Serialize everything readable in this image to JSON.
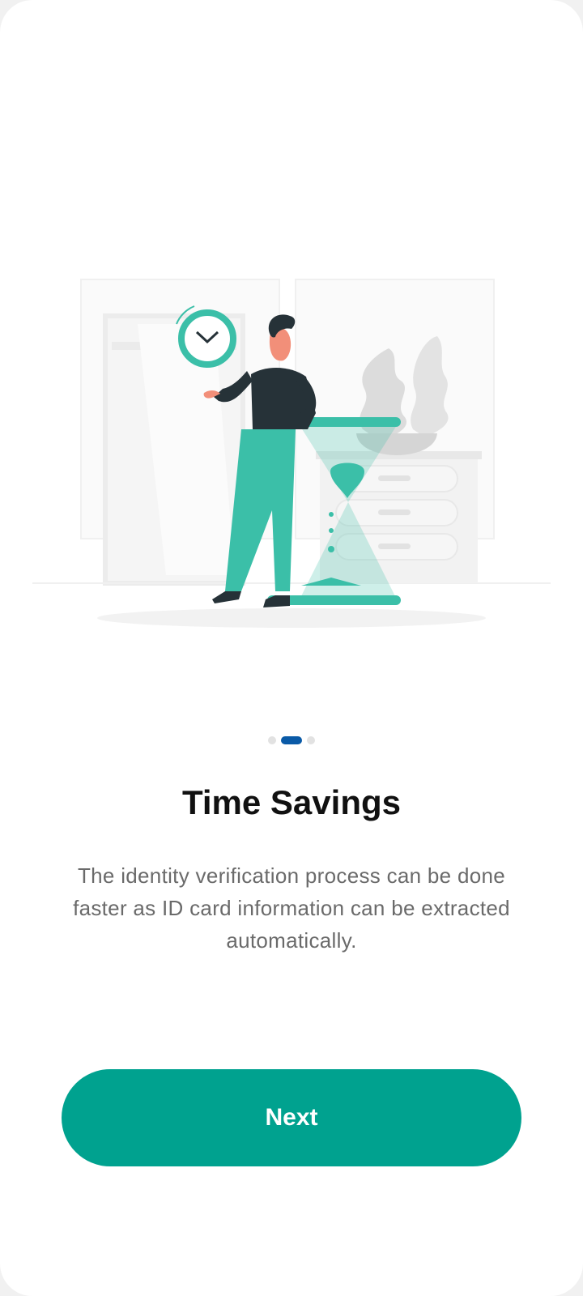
{
  "onboarding": {
    "title": "Time Savings",
    "description": "The identity verification process can be done faster as ID card information can be extracted automatically.",
    "next_label": "Next",
    "pager": {
      "total": 3,
      "active_index": 1
    },
    "illustration_icon": "person-with-clock-and-hourglass-illustration"
  },
  "colors": {
    "accent": "#00a28f",
    "illustration_teal": "#3bbfa8",
    "pager_active": "#0a5aa7",
    "pager_inactive": "#e2e2e2",
    "title": "#111111",
    "description": "#6a6a6a"
  }
}
